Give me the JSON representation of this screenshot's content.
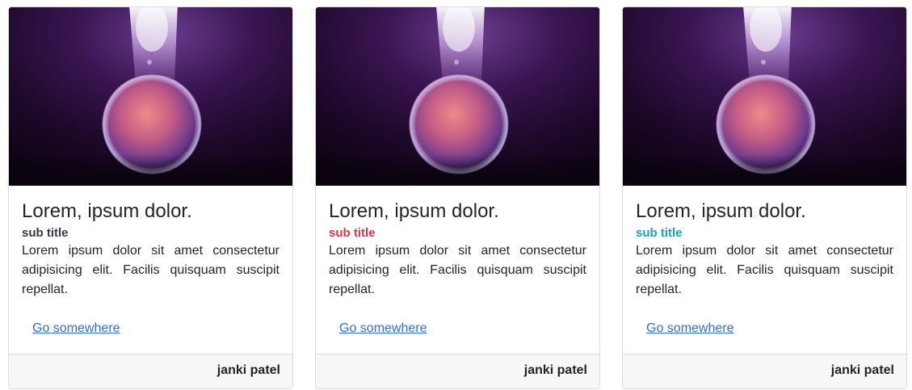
{
  "cards": [
    {
      "title": "Lorem, ipsum dolor.",
      "subtitle": "sub title",
      "subtitle_color": "#343a40",
      "text": "Lorem ipsum dolor sit amet consectetur adipisicing elit. Facilis quisquam suscipit repellat.",
      "link": "Go somewhere",
      "footer": "janki patel",
      "image": "planet-nebula-image"
    },
    {
      "title": "Lorem, ipsum dolor.",
      "subtitle": "sub title",
      "subtitle_color": "#dc3545",
      "text": "Lorem ipsum dolor sit amet consectetur adipisicing elit. Facilis quisquam suscipit repellat.",
      "link": "Go somewhere",
      "footer": "janki patel",
      "image": "planet-nebula-image"
    },
    {
      "title": "Lorem, ipsum dolor.",
      "subtitle": "sub title",
      "subtitle_color": "#17a2b8",
      "text": "Lorem ipsum dolor sit amet consectetur adipisicing elit. Facilis quisquam suscipit repellat.",
      "link": "Go somewhere",
      "footer": "janki patel",
      "image": "planet-nebula-image"
    }
  ]
}
